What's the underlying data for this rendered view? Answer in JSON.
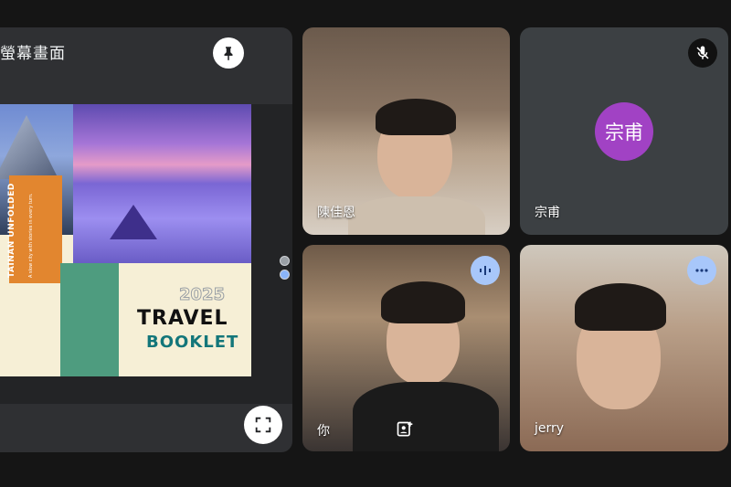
{
  "presentation": {
    "title": "螢幕畫面",
    "slide": {
      "vertical_title": "TAINAN UNFOLDED",
      "vertical_sub": "A slow city with stories in every turn.",
      "year": "2025",
      "line1": "TRAVEL",
      "line2": "BOOKLET"
    }
  },
  "participants": [
    {
      "name": "陳佳恩"
    },
    {
      "name": "宗甫",
      "avatar_text": "宗甫"
    },
    {
      "name": "你"
    },
    {
      "name": "jerry"
    }
  ],
  "icons": {
    "pin": "pin-icon",
    "fullscreen": "fullscreen-icon",
    "mic_off": "mic-off-icon",
    "audio": "audio-level-icon",
    "more": "more-options-icon",
    "reframe": "reframe-icon"
  },
  "colors": {
    "background": "#151515",
    "tile": "#3c4043",
    "avatar": "#a142c4",
    "accent": "#a8c7fa"
  }
}
